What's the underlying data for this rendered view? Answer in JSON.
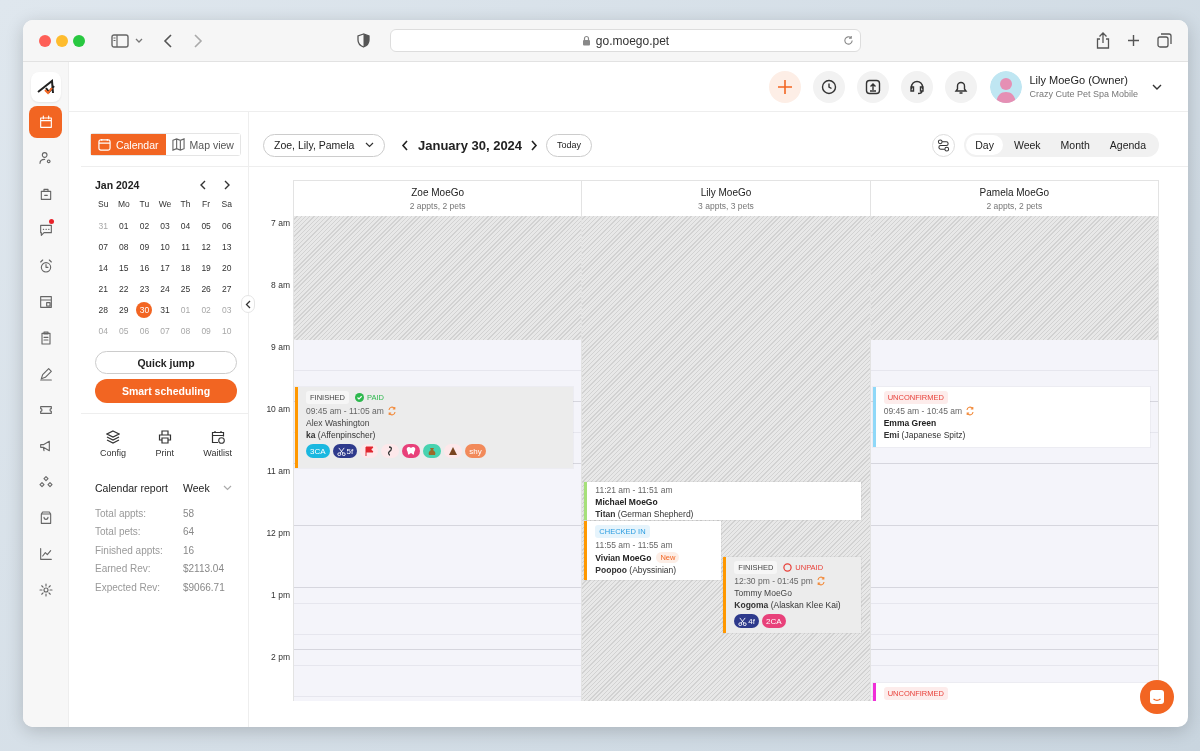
{
  "browser": {
    "url": "go.moego.pet"
  },
  "rail": [
    {
      "selected": true,
      "dot": false
    },
    {
      "selected": false,
      "dot": false
    },
    {
      "selected": false,
      "dot": false
    },
    {
      "selected": false,
      "dot": true
    },
    {
      "selected": false,
      "dot": false
    },
    {
      "selected": false,
      "dot": false
    },
    {
      "selected": false,
      "dot": false
    },
    {
      "selected": false,
      "dot": false
    },
    {
      "selected": false,
      "dot": false
    },
    {
      "selected": false,
      "dot": false
    },
    {
      "selected": false,
      "dot": false
    },
    {
      "selected": false,
      "dot": false
    },
    {
      "selected": false,
      "dot": false
    },
    {
      "selected": false,
      "dot": false
    }
  ],
  "user": {
    "name": "Lily MoeGo (Owner)",
    "business": "Crazy Cute Pet Spa Mobile"
  },
  "view_toggle": [
    {
      "label": "Calendar",
      "selected": true
    },
    {
      "label": "Map view",
      "selected": false
    }
  ],
  "mini_calendar": {
    "month": "Jan 2024",
    "weekdays": [
      "Su",
      "Mo",
      "Tu",
      "We",
      "Th",
      "Fr",
      "Sa"
    ],
    "weeks": [
      [
        {
          "d": "31",
          "outside": true,
          "selected": false
        },
        {
          "d": "01",
          "outside": false,
          "selected": false
        },
        {
          "d": "02",
          "outside": false,
          "selected": false
        },
        {
          "d": "03",
          "outside": false,
          "selected": false
        },
        {
          "d": "04",
          "outside": false,
          "selected": false
        },
        {
          "d": "05",
          "outside": false,
          "selected": false
        },
        {
          "d": "06",
          "outside": false,
          "selected": false
        }
      ],
      [
        {
          "d": "07",
          "outside": false,
          "selected": false
        },
        {
          "d": "08",
          "outside": false,
          "selected": false
        },
        {
          "d": "09",
          "outside": false,
          "selected": false
        },
        {
          "d": "10",
          "outside": false,
          "selected": false
        },
        {
          "d": "11",
          "outside": false,
          "selected": false
        },
        {
          "d": "12",
          "outside": false,
          "selected": false
        },
        {
          "d": "13",
          "outside": false,
          "selected": false
        }
      ],
      [
        {
          "d": "14",
          "outside": false,
          "selected": false
        },
        {
          "d": "15",
          "outside": false,
          "selected": false
        },
        {
          "d": "16",
          "outside": false,
          "selected": false
        },
        {
          "d": "17",
          "outside": false,
          "selected": false
        },
        {
          "d": "18",
          "outside": false,
          "selected": false
        },
        {
          "d": "19",
          "outside": false,
          "selected": false
        },
        {
          "d": "20",
          "outside": false,
          "selected": false
        }
      ],
      [
        {
          "d": "21",
          "outside": false,
          "selected": false
        },
        {
          "d": "22",
          "outside": false,
          "selected": false
        },
        {
          "d": "23",
          "outside": false,
          "selected": false
        },
        {
          "d": "24",
          "outside": false,
          "selected": false
        },
        {
          "d": "25",
          "outside": false,
          "selected": false
        },
        {
          "d": "26",
          "outside": false,
          "selected": false
        },
        {
          "d": "27",
          "outside": false,
          "selected": false
        }
      ],
      [
        {
          "d": "28",
          "outside": false,
          "selected": false
        },
        {
          "d": "29",
          "outside": false,
          "selected": false
        },
        {
          "d": "30",
          "outside": false,
          "selected": true
        },
        {
          "d": "31",
          "outside": false,
          "selected": false
        },
        {
          "d": "01",
          "outside": true,
          "selected": false
        },
        {
          "d": "02",
          "outside": true,
          "selected": false
        },
        {
          "d": "03",
          "outside": true,
          "selected": false
        }
      ],
      [
        {
          "d": "04",
          "outside": true,
          "selected": false
        },
        {
          "d": "05",
          "outside": true,
          "selected": false
        },
        {
          "d": "06",
          "outside": true,
          "selected": false
        },
        {
          "d": "07",
          "outside": true,
          "selected": false
        },
        {
          "d": "08",
          "outside": true,
          "selected": false
        },
        {
          "d": "09",
          "outside": true,
          "selected": false
        },
        {
          "d": "10",
          "outside": true,
          "selected": false
        }
      ]
    ]
  },
  "quick_jump": "Quick jump",
  "smart_scheduling": "Smart scheduling",
  "tools": [
    "Config",
    "Print",
    "Waitlist"
  ],
  "report": {
    "title": "Calendar report",
    "period": "Week",
    "stats": [
      {
        "label": "Total appts:",
        "value": "58"
      },
      {
        "label": "Total pets:",
        "value": "64"
      },
      {
        "label": "Finished appts:",
        "value": "16"
      },
      {
        "label": "Earned Rev:",
        "value": "$2113.04"
      },
      {
        "label": "Expected Rev:",
        "value": "$9066.71"
      }
    ]
  },
  "toolbar": {
    "staff": "Zoe, Lily, Pamela",
    "date": "January 30, 2024",
    "today": "Today",
    "views": [
      {
        "label": "Day",
        "selected": true
      },
      {
        "label": "Week",
        "selected": false
      },
      {
        "label": "Month",
        "selected": false
      },
      {
        "label": "Agenda",
        "selected": false
      }
    ]
  },
  "hours": [
    "7 am",
    "8 am",
    "9 am",
    "10 am",
    "11 am",
    "12 pm",
    "1 pm",
    "2 pm"
  ],
  "columns": [
    {
      "name": "Zoe MoeGo",
      "summary": "2 appts, 2 pets",
      "fully_blocked": false,
      "events": [
        {
          "color": "#ff9800",
          "status": {
            "kind": "finished",
            "label": "FINISHED"
          },
          "payment": {
            "paid": true,
            "label": "PAID"
          },
          "time": "09:45 am - 11:05 am",
          "repeat": true,
          "client": "Alex Washington",
          "pet": "**ka** (Affenpinscher)",
          "tags": [
            {
              "kind": "text",
              "label": "3CA",
              "color": "#1ab8e0"
            },
            {
              "kind": "scissors",
              "label": "5f",
              "color": "#2e3a8c"
            },
            {
              "kind": "flag",
              "color": "#fde8ea"
            },
            {
              "kind": "hook",
              "color": "#fde8ea"
            },
            {
              "kind": "tooth",
              "color": "#e8417a"
            },
            {
              "kind": "bag",
              "color": "#47d3b0"
            },
            {
              "kind": "pile",
              "color": "#fde8ea"
            },
            {
              "kind": "text",
              "label": "shy",
              "color": "#f28a5a"
            }
          ]
        }
      ]
    },
    {
      "name": "Lily MoeGo",
      "summary": "3 appts, 3 pets",
      "fully_blocked": true,
      "events": [
        {
          "color": "#a6e07a",
          "time": "11:21 am - 11:51 am",
          "repeat": false,
          "client": "Michael MoeGo",
          "pet": "**Titan** (German Shepherd)"
        },
        {
          "color": "#ff9800",
          "status": {
            "kind": "checked_in",
            "label": "CHECKED IN"
          },
          "time": "11:55 am - 11:55 am",
          "repeat": false,
          "client": "Vivian MoeGo",
          "badge": "New",
          "pet": "**Poopoo** (Abyssinian)"
        },
        {
          "color": "#ff9800",
          "status": {
            "kind": "finished",
            "label": "FINISHED"
          },
          "payment": {
            "paid": false,
            "label": "UNPAID"
          },
          "time": "12:30 pm - 01:45 pm",
          "repeat": true,
          "client": "Tommy MoeGo",
          "pet": "**Kogoma** (Alaskan Klee Kai)",
          "tags": [
            {
              "kind": "scissors",
              "label": "4f",
              "color": "#2e3a8c"
            },
            {
              "kind": "text",
              "label": "2CA",
              "color": "#e8417a"
            }
          ]
        }
      ]
    },
    {
      "name": "Pamela MoeGo",
      "summary": "2 appts, 2 pets",
      "fully_blocked": false,
      "events": [
        {
          "color": "#8fd8f8",
          "status": {
            "kind": "unconfirmed",
            "label": "UNCONFIRMED"
          },
          "time": "09:45 am - 10:45 am",
          "repeat": true,
          "client": "Emma Green",
          "pet": "**Emi** (Japanese Spitz)"
        },
        {
          "color": "#f02fd8",
          "status": {
            "kind": "unconfirmed",
            "label": "UNCONFIRMED"
          }
        }
      ]
    }
  ]
}
